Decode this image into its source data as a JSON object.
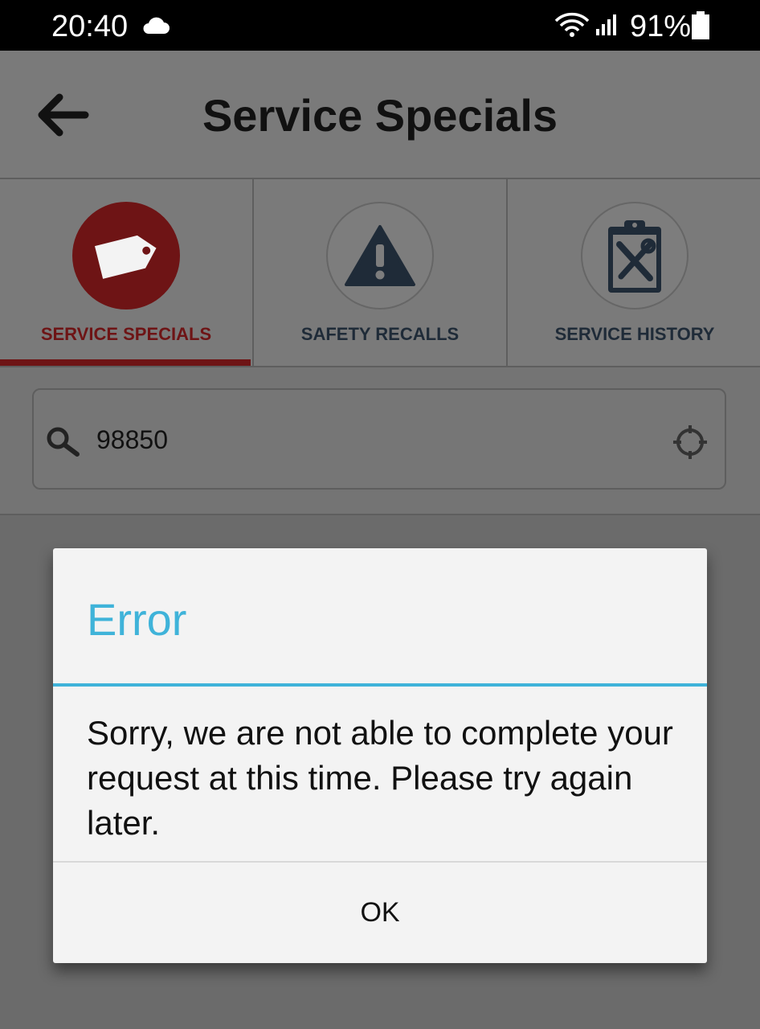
{
  "status_bar": {
    "time": "20:40",
    "battery": "91%",
    "icons": [
      "cloud-icon",
      "wifi-icon",
      "signal-icon",
      "battery-icon"
    ]
  },
  "header": {
    "title": "Service Specials",
    "back_icon": "arrow-left-icon"
  },
  "tabs": [
    {
      "label": "SERVICE SPECIALS",
      "icon": "tag-icon",
      "active": true
    },
    {
      "label": "SAFETY RECALLS",
      "icon": "warning-icon",
      "active": false
    },
    {
      "label": "SERVICE HISTORY",
      "icon": "clipboard-tools-icon",
      "active": false
    }
  ],
  "search": {
    "value": "98850",
    "icon": "search-icon",
    "locate_icon": "crosshair-icon"
  },
  "dialog": {
    "title": "Error",
    "message": "Sorry, we are not able to complete your request at this time. Please try again later.",
    "ok_label": "OK"
  },
  "colors": {
    "accent_red": "#6e1415",
    "dialog_accent": "#3fb3d9",
    "tab_text": "#1f2b38"
  }
}
